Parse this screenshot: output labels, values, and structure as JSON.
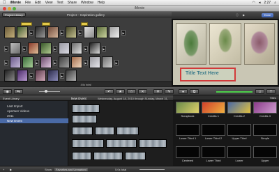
{
  "menubar": {
    "app": "iMovie",
    "items": [
      "File",
      "Edit",
      "View",
      "Text",
      "Share",
      "Window",
      "Help"
    ],
    "clock": "2:27"
  },
  "window": {
    "title": "iMovie"
  },
  "project_panel": {
    "library_button": "Project Library",
    "title": "Project – Inspiration gallery",
    "duration": "44s total"
  },
  "viewer": {
    "done_label": "Done",
    "overlay_title": "Title Text Here"
  },
  "event_library": {
    "header": "Event Library",
    "items": [
      "Last Import",
      "Aperture Videos",
      "2011",
      "New Event"
    ]
  },
  "event_browser": {
    "title": "New Event",
    "date_range": "Wednesday, August 18, 2010 through Sunday, March 31,"
  },
  "titles_browser": {
    "header": "Titles",
    "rows": [
      [
        "Scrapbook",
        "Credits 1",
        "Credits 2",
        "Credits 3"
      ],
      [
        "Lower Third 1",
        "Lower Third 2",
        "Upper Third",
        "Simple"
      ],
      [
        "Centered",
        "Lower Third",
        "Lower",
        "Upper"
      ]
    ]
  },
  "bottom": {
    "show_label": "Show:",
    "show_value": "Favorites and Unmarked",
    "duration": "5.0s total"
  },
  "colors": {
    "accent_blue": "#4a6aa6",
    "title_frame": "#d23a3a",
    "project_tag": "#e3c94a"
  }
}
